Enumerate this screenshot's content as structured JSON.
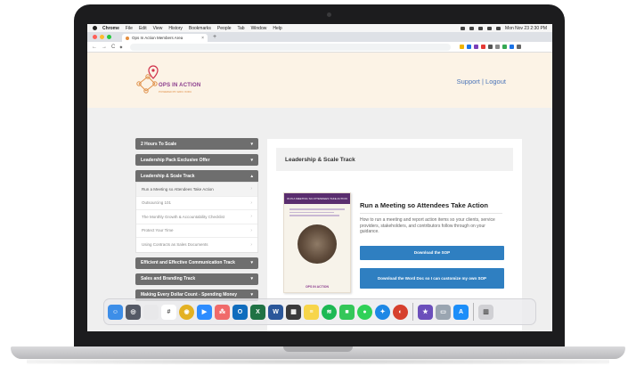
{
  "menubar": {
    "app": "Chrome",
    "items": [
      "File",
      "Edit",
      "View",
      "History",
      "Bookmarks",
      "People",
      "Tab",
      "Window",
      "Help"
    ],
    "clock": "Mon Nov 23  2:30 PM"
  },
  "browser": {
    "tab_title": "Ops In Action Members Area",
    "tab_close": "×",
    "new_tab": "+",
    "back": "←",
    "forward": "→",
    "reload": "C",
    "lock": "◆"
  },
  "site": {
    "logo_text": "OPS IN ACTION",
    "logo_sub": "POWERED BY ERIC IKIRU",
    "support_link": "Support",
    "separator": "|",
    "logout_link": "Logout"
  },
  "sidebar": {
    "tracks_before": [
      {
        "label": "2 Hours To Scale",
        "chevron": "▾"
      },
      {
        "label": "Leadership Pack Exclusive Offer",
        "chevron": "▾"
      }
    ],
    "open_track": {
      "label": "Leadership & Scale Track",
      "chevron": "▴"
    },
    "lessons": [
      {
        "label": "Run a Meeting so Attendees Take Action",
        "arrow": "›"
      },
      {
        "label": "Outsourcing 101",
        "arrow": "›"
      },
      {
        "label": "The Monthly Growth & Accountability Checklist",
        "arrow": "›"
      },
      {
        "label": "Protect Your Time",
        "arrow": "›"
      },
      {
        "label": "Using Contracts as Sales Documents",
        "arrow": "›"
      }
    ],
    "tracks_after": [
      {
        "label": "Efficient and Effective Communication Track",
        "chevron": "▾"
      },
      {
        "label": "Sales and Branding Track",
        "chevron": "▾"
      },
      {
        "label": "Making Every Dollar Count - Spending Money",
        "chevron": "▾"
      }
    ]
  },
  "content": {
    "track_title": "Leadership & Scale Track",
    "lesson_title": "Run a Meeting so Attendees Take Action",
    "description": "How to run a meeting and report action items so your clients, service providers, stakeholders, and contributors follow through on your guidance.",
    "button_sop": "Download the SOP",
    "button_word": "Download the Word Doc so I can customize my own SOP",
    "thumbnail": {
      "heading": "RUN A MEETING SO ATTENDEES TAKE ACTION",
      "footer": "OPS IN ACTION"
    }
  },
  "colors": {
    "header_bg": "#fcf3e6",
    "track_bg": "#6e6e6e",
    "button_bg": "#2f7fc1",
    "link": "#4a74b8",
    "logo_purple": "#8a3a8c"
  },
  "dock": {
    "apps": [
      {
        "name": "finder-icon",
        "color": "#3d8ee8",
        "glyph": "☺"
      },
      {
        "name": "launchpad-icon",
        "color": "#555a66",
        "glyph": "◎"
      },
      {
        "name": "apps-grid-icon",
        "color": "#e8e8ea",
        "glyph": ""
      },
      {
        "name": "slack-icon",
        "color": "#ffffff",
        "glyph": "#"
      },
      {
        "name": "chrome-icon",
        "color": "#e3b123",
        "glyph": "◉"
      },
      {
        "name": "zoom-icon",
        "color": "#2d8cff",
        "glyph": "▶"
      },
      {
        "name": "asana-icon",
        "color": "#f06a6a",
        "glyph": "⁂"
      },
      {
        "name": "outlook-icon",
        "color": "#0f6cbd",
        "glyph": "O"
      },
      {
        "name": "excel-icon",
        "color": "#1f7244",
        "glyph": "X"
      },
      {
        "name": "word-icon",
        "color": "#2b579a",
        "glyph": "W"
      },
      {
        "name": "calculator-icon",
        "color": "#3a3a3c",
        "glyph": "▦"
      },
      {
        "name": "notes-icon",
        "color": "#f7d54a",
        "glyph": "≡"
      },
      {
        "name": "spotify-icon",
        "color": "#1db954",
        "glyph": "≋"
      },
      {
        "name": "facetime-icon",
        "color": "#34c759",
        "glyph": "■"
      },
      {
        "name": "messages-icon",
        "color": "#30d158",
        "glyph": "●"
      },
      {
        "name": "safari-icon",
        "color": "#1e88e5",
        "glyph": "✦"
      },
      {
        "name": "screenflow-icon",
        "color": "#d6402e",
        "glyph": "◐"
      },
      {
        "name": "imovie-icon",
        "color": "#6b4fbb",
        "glyph": "★"
      },
      {
        "name": "preview-icon",
        "color": "#9aa5b1",
        "glyph": "▭"
      },
      {
        "name": "app-store-icon",
        "color": "#1c8ef9",
        "glyph": "A"
      },
      {
        "name": "trash-icon",
        "color": "#d0d0d4",
        "glyph": "▥"
      }
    ]
  }
}
